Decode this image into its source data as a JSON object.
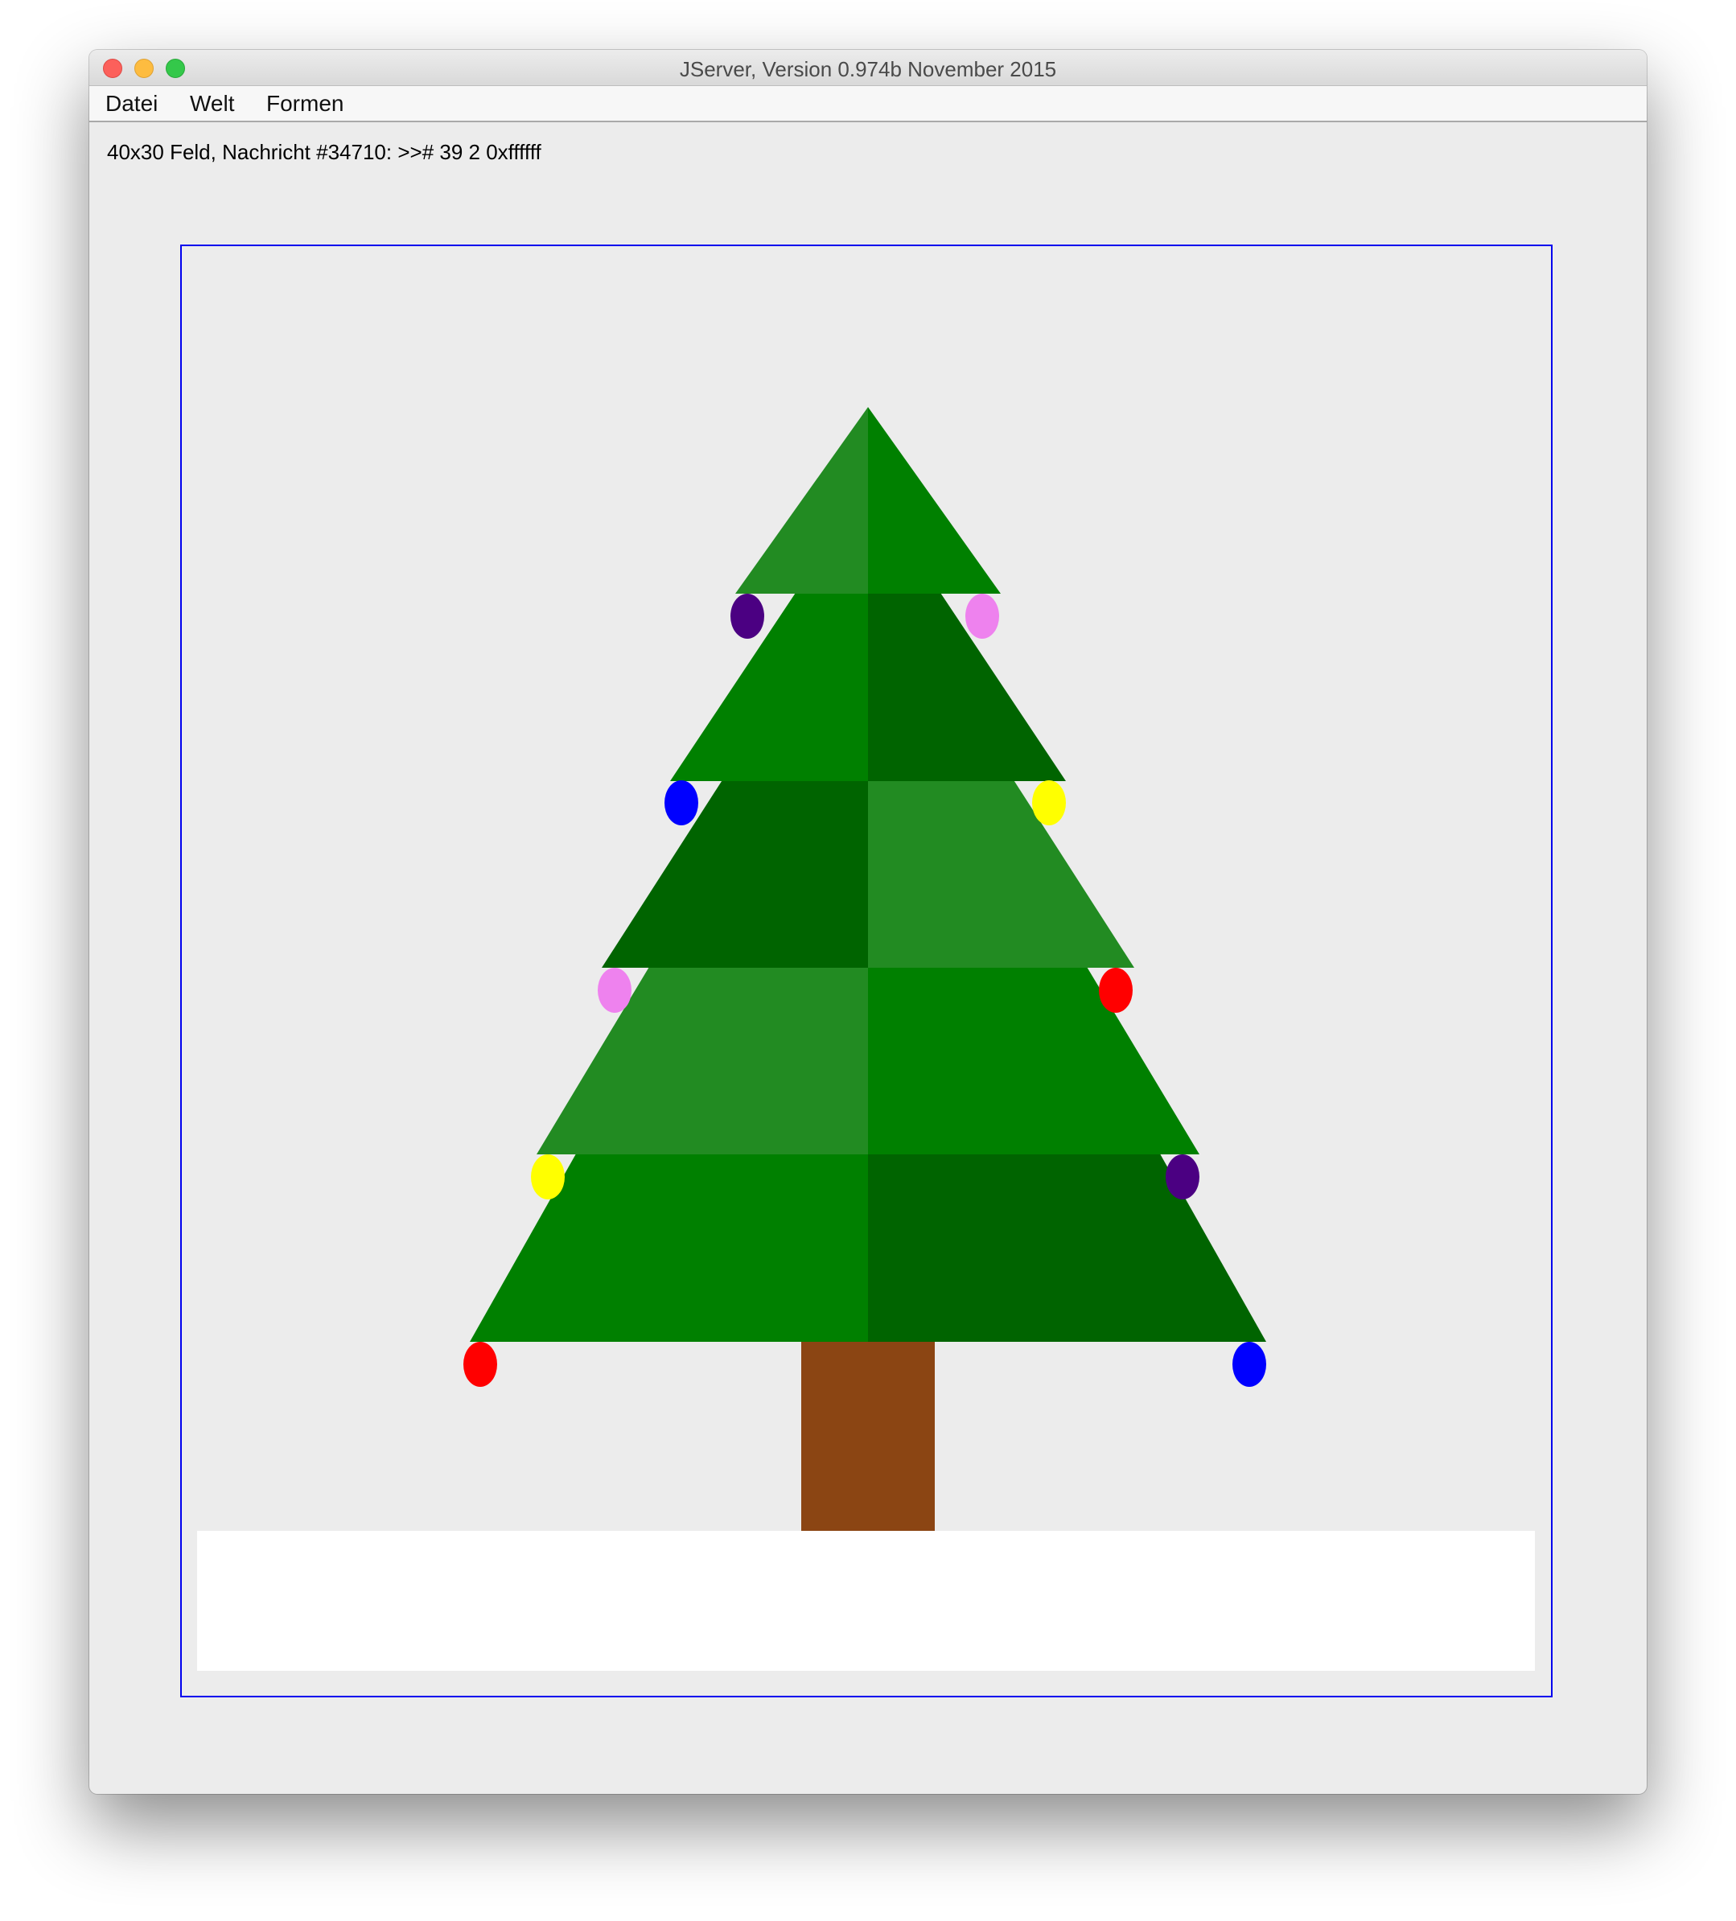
{
  "window": {
    "title": "JServer, Version 0.974b November 2015",
    "traffic_lights": [
      "close-button",
      "minimize-button",
      "zoom-button"
    ]
  },
  "menu": {
    "items": [
      "Datei",
      "Welt",
      "Formen"
    ]
  },
  "status": {
    "text": "40x30 Feld, Nachricht #34710: >># 39 2 0xffffff"
  },
  "colors": {
    "background": "#ececec",
    "frame": "#0000ee",
    "tier_left": [
      "#228b22",
      "#008000",
      "#006400",
      "#228b22",
      "#008000"
    ],
    "tier_right": [
      "#008000",
      "#006400",
      "#228b22",
      "#008000",
      "#006400"
    ],
    "trunk": "#8b4513",
    "snow": "#ffffff"
  },
  "ornaments": {
    "left": [
      "#4b0082",
      "#0000ff",
      "#ee82ee",
      "#ffff00",
      "#ff0000"
    ],
    "right": [
      "#ee82ee",
      "#ffff00",
      "#ff0000",
      "#4b0082",
      "#0000ff"
    ]
  }
}
